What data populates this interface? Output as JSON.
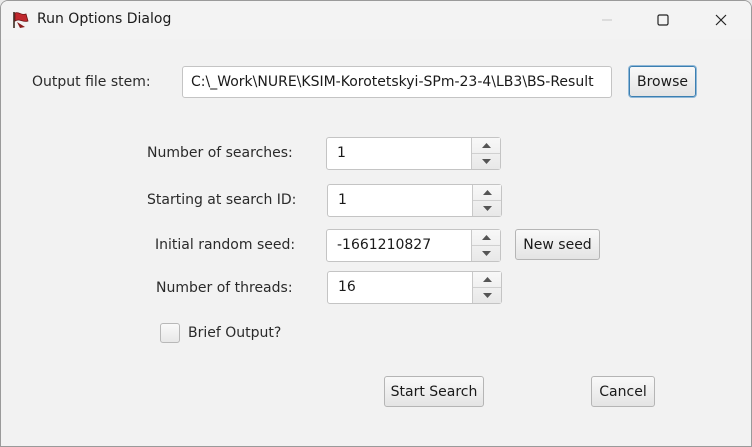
{
  "window": {
    "title": "Run Options Dialog",
    "controls": {
      "minimize": "minimize-icon",
      "maximize": "maximize-icon",
      "close": "close-icon"
    }
  },
  "output": {
    "label": "Output file stem:",
    "value": "C:\\_Work\\NURE\\KSIM-Korotetskyi-SPm-23-4\\LB3\\BS-Result",
    "browse_label": "Browse"
  },
  "fields": {
    "num_searches": {
      "label": "Number of searches:",
      "value": "1"
    },
    "start_id": {
      "label": "Starting at search ID:",
      "value": "1"
    },
    "seed": {
      "label": "Initial random seed:",
      "value": "-1661210827",
      "new_seed_label": "New seed"
    },
    "threads": {
      "label": "Number of threads:",
      "value": "16"
    }
  },
  "brief": {
    "label": "Brief Output?",
    "checked": false
  },
  "actions": {
    "start": "Start Search",
    "cancel": "Cancel"
  },
  "colors": {
    "focus_border": "#3c7fb1",
    "background": "#f2f2f2",
    "app_icon": "#c0282d"
  }
}
